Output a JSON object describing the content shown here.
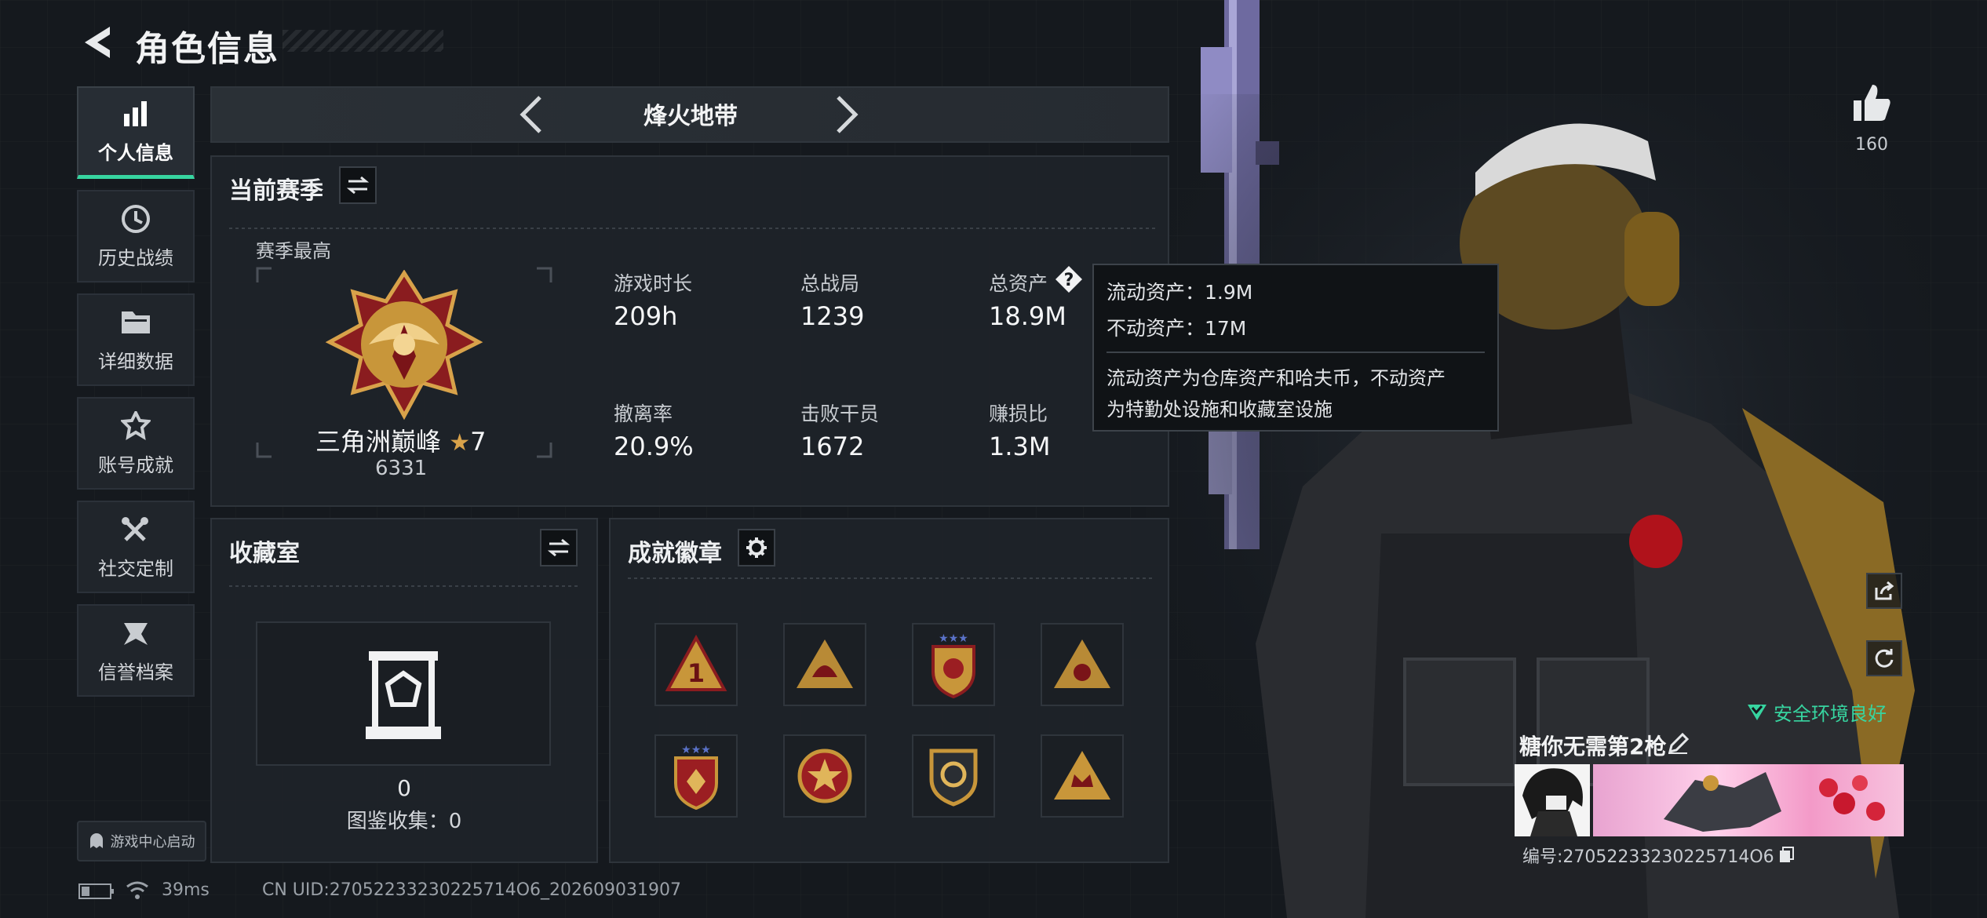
{
  "header": {
    "title": "角色信息"
  },
  "sidebar": {
    "items": [
      {
        "label": "个人信息",
        "icon": "bar-chart-icon",
        "active": true
      },
      {
        "label": "历史战绩",
        "icon": "clock-icon",
        "active": false
      },
      {
        "label": "详细数据",
        "icon": "folder-icon",
        "active": false
      },
      {
        "label": "账号成就",
        "icon": "achievement-icon",
        "active": false
      },
      {
        "label": "社交定制",
        "icon": "tools-icon",
        "active": false
      },
      {
        "label": "信誉档案",
        "icon": "credit-icon",
        "active": false
      }
    ],
    "launch_label": "游戏中心启动"
  },
  "mode": {
    "name": "烽火地带"
  },
  "current_season": {
    "title": "当前赛季",
    "best_label": "赛季最高",
    "rank_name": "三角洲巅峰",
    "rank_stars": "7",
    "rank_score": "6331",
    "stats": [
      {
        "label": "游戏时长",
        "value": "209h"
      },
      {
        "label": "总战局",
        "value": "1239"
      },
      {
        "label": "总资产",
        "value": "18.9M"
      },
      {
        "label": "撤离率",
        "value": "20.9%"
      },
      {
        "label": "击败干员",
        "value": "1672"
      },
      {
        "label": "赚损比",
        "value": "1.3M"
      }
    ]
  },
  "tooltip": {
    "line1": "流动资产：1.9M",
    "line2": "不动资产：17M",
    "desc1": "流动资产为仓库资产和哈夫币，不动资产",
    "desc2": "为特勤处设施和收藏室设施"
  },
  "collection": {
    "title": "收藏室",
    "count": "0",
    "catalog": "图鉴收集：0"
  },
  "badges": {
    "title": "成就徽章",
    "items": [
      "badge-1-icon",
      "badge-helmet-icon",
      "badge-shield-stars-icon",
      "badge-flower-icon",
      "badge-shield-diamond-icon",
      "badge-medal-icon",
      "badge-gear-shield-icon",
      "badge-crown-icon"
    ]
  },
  "right": {
    "likes": "160",
    "security": "安全环境良好",
    "player_name": "糖你无需第2枪",
    "player_id": "编号:27052233230225714O6"
  },
  "status": {
    "ping": "39ms",
    "uid": "CN UID:27052233230225714O6_20260903190​7"
  },
  "colors": {
    "accent": "#37d5a0",
    "gold": "#c8963a",
    "panel": "#1e2329"
  }
}
